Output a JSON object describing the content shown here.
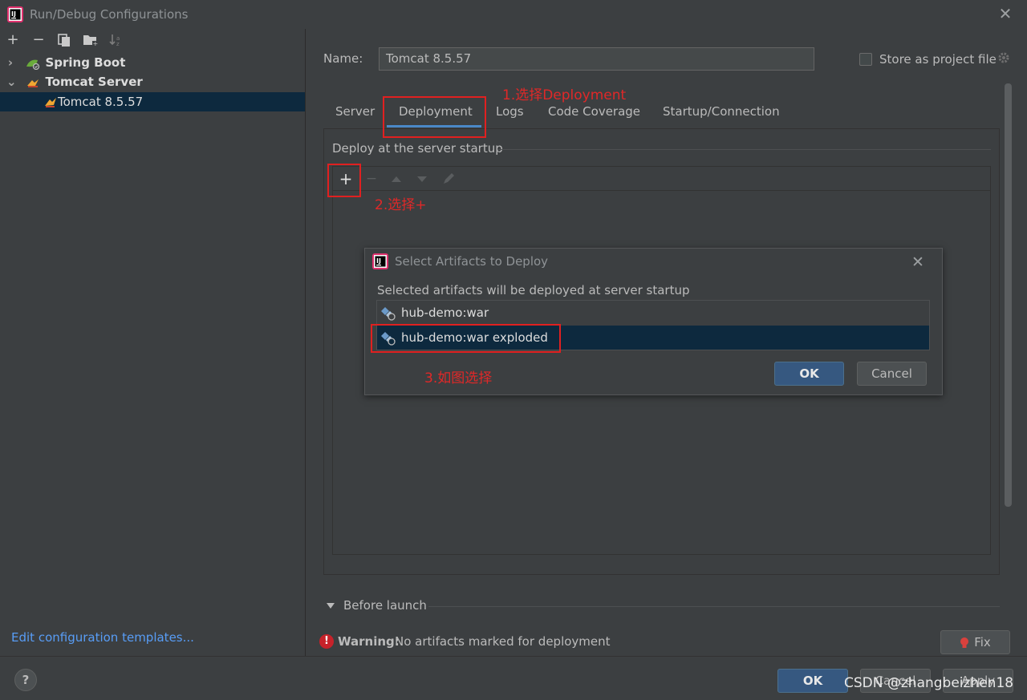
{
  "window": {
    "title": "Run/Debug Configurations",
    "close": "✕"
  },
  "left": {
    "toolbar": {
      "add": "+",
      "remove": "−",
      "copy": "⧉",
      "folder": "▰",
      "sort": "↓"
    },
    "tree": [
      {
        "label": "Spring Boot",
        "chevron": "›"
      },
      {
        "label": "Tomcat Server",
        "chevron": "⌄"
      },
      {
        "label": "Tomcat 8.5.57"
      }
    ],
    "edit_templates": "Edit configuration templates..."
  },
  "config": {
    "name_label": "Name:",
    "name_value": "Tomcat 8.5.57",
    "store_label": "Store as project file",
    "tabs": [
      "Server",
      "Deployment",
      "Logs",
      "Code Coverage",
      "Startup/Connection"
    ],
    "deploy_section": "Deploy at the server startup"
  },
  "dialog": {
    "title": "Select Artifacts to Deploy",
    "description": "Selected artifacts will be deployed at server startup",
    "artifacts": [
      "hub-demo:war",
      "hub-demo:war exploded"
    ],
    "selected_artifact": "hub-demo:war exploded",
    "ok": "OK",
    "cancel": "Cancel"
  },
  "annotations": {
    "step1": "1.选择Deployment",
    "step2": "2.选择+",
    "step3": "3.如图选择"
  },
  "before_launch": "Before launch",
  "warning": {
    "bold": "Warning:",
    "text": "No artifacts marked for deployment"
  },
  "buttons": {
    "fix": "Fix",
    "ok": "OK",
    "cancel": "Cancel",
    "apply": "Apply",
    "help": "?"
  },
  "watermark": "CSDN @zhangbeizhen18",
  "colors": {
    "accent": "#4a88c7",
    "selection": "#0d293e",
    "annotation": "#e02020",
    "link": "#589df6"
  }
}
